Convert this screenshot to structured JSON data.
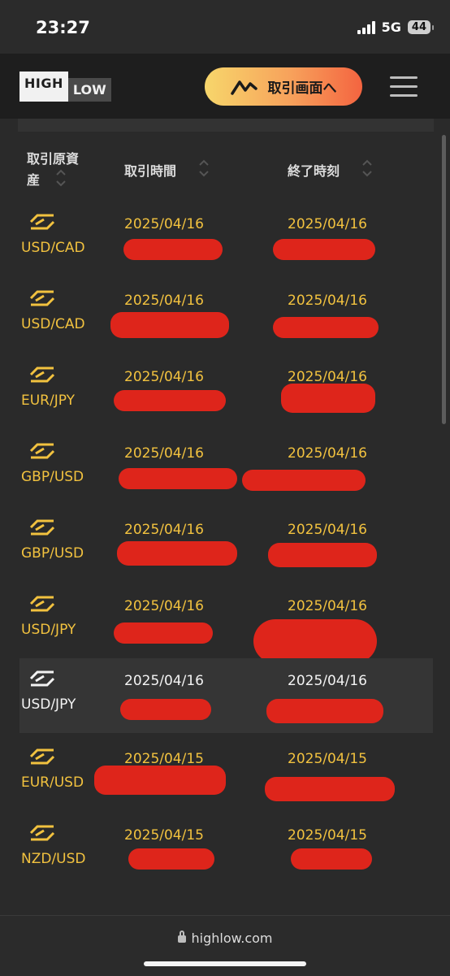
{
  "status_bar": {
    "time": "23:27",
    "network": "5G",
    "battery": "44"
  },
  "header": {
    "logo_high": "HIGH",
    "logo_low": "LOW",
    "trade_button": "取引画面へ"
  },
  "table": {
    "columns": {
      "asset_line1": "取引原資",
      "asset_line2": "産",
      "trade_time": "取引時間",
      "end_time": "終了時刻"
    },
    "rows": [
      {
        "asset": "USD/CAD",
        "trade_date": "2025/04/16",
        "end_date": "2025/04/16",
        "active": false
      },
      {
        "asset": "USD/CAD",
        "trade_date": "2025/04/16",
        "end_date": "2025/04/16",
        "active": false
      },
      {
        "asset": "EUR/JPY",
        "trade_date": "2025/04/16",
        "end_date": "2025/04/16",
        "active": false
      },
      {
        "asset": "GBP/USD",
        "trade_date": "2025/04/16",
        "end_date": "2025/04/16",
        "active": false
      },
      {
        "asset": "GBP/USD",
        "trade_date": "2025/04/16",
        "end_date": "2025/04/16",
        "active": false
      },
      {
        "asset": "USD/JPY",
        "trade_date": "2025/04/16",
        "end_date": "2025/04/16",
        "active": false
      },
      {
        "asset": "USD/JPY",
        "trade_date": "2025/04/16",
        "end_date": "2025/04/16",
        "active": true
      },
      {
        "asset": "EUR/USD",
        "trade_date": "2025/04/15",
        "end_date": "2025/04/15",
        "active": false
      },
      {
        "asset": "NZD/USD",
        "trade_date": "2025/04/15",
        "end_date": "2025/04/15",
        "active": false
      }
    ]
  },
  "browser": {
    "url": "highlow.com"
  },
  "colors": {
    "accent": "#f2c23f",
    "redaction": "#e8251a",
    "background": "#2a2a2a"
  }
}
